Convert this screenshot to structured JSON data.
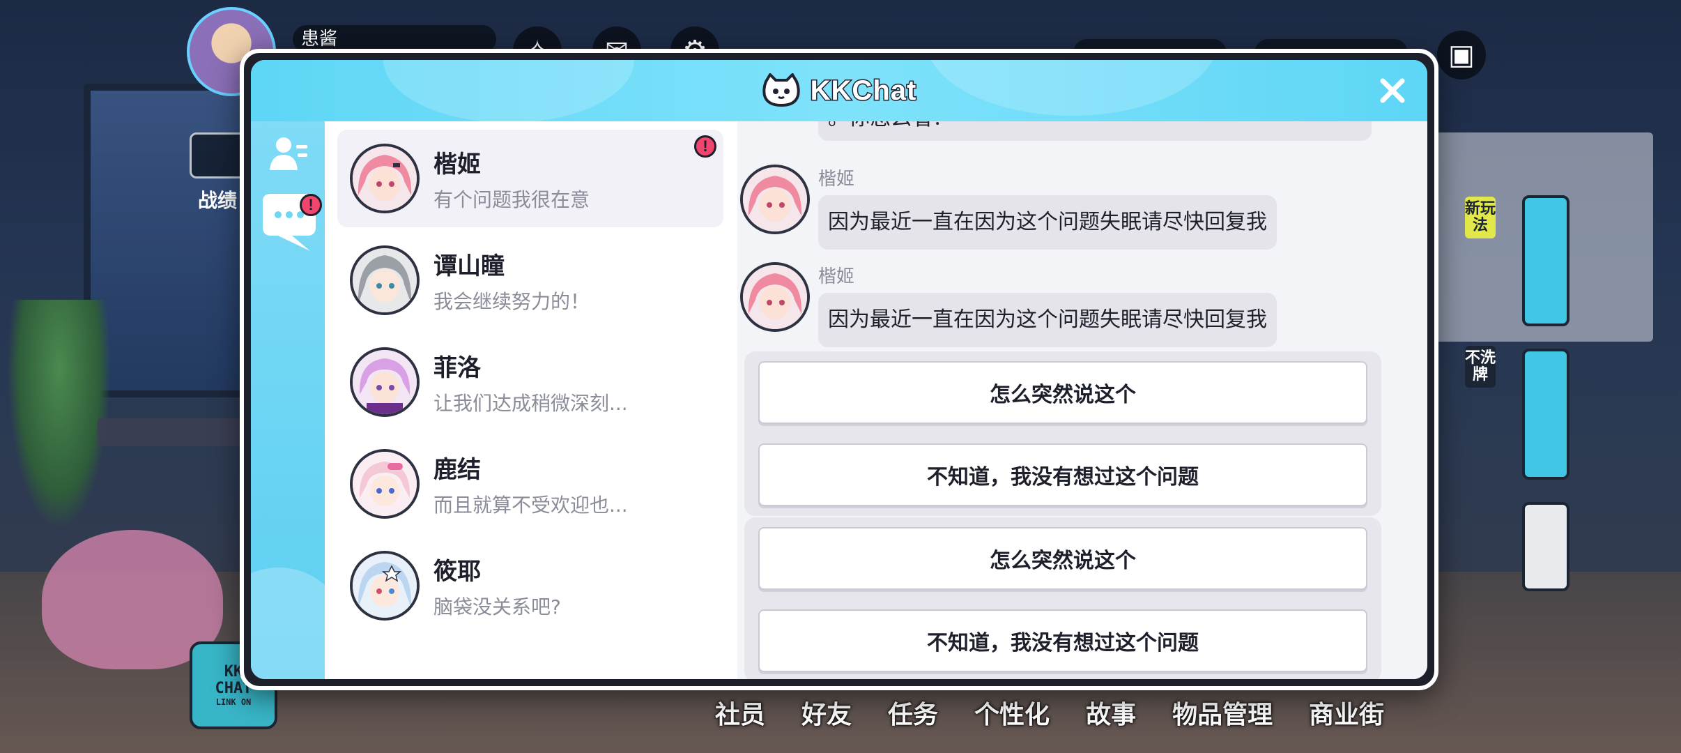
{
  "background": {
    "player_name": "患酱",
    "side_button_label": "战绩",
    "right_tags": [
      "新玩法",
      "不洗牌"
    ],
    "kkchat_button": [
      "KK",
      "CHAT",
      "LINK ON"
    ],
    "bottom_nav": [
      "社员",
      "好友",
      "任务",
      "个性化",
      "故事",
      "物品管理",
      "商业街"
    ]
  },
  "modal": {
    "title": "KKChat",
    "badge_glyph": "!",
    "rail": {
      "contacts_icon": "contacts-icon",
      "chat_icon": "chat-bubble-icon"
    },
    "contacts": [
      {
        "name": "楷姬",
        "preview": "有个问题我很在意",
        "active": true,
        "unread": true,
        "hair": "#f08aa0"
      },
      {
        "name": "谭山瞳",
        "preview": "我会继续努力的！",
        "active": false,
        "unread": false,
        "hair": "#9aa0a6"
      },
      {
        "name": "菲洛",
        "preview": "让我们达成稍微深刻...",
        "active": false,
        "unread": false,
        "hair": "#d9a0e6"
      },
      {
        "name": "鹿结",
        "preview": "而且就算不受欢迎也...",
        "active": false,
        "unread": false,
        "hair": "#f4c8d4"
      },
      {
        "name": "筱耶",
        "preview": "脑袋没关系吧?",
        "active": false,
        "unread": false,
        "hair": "#bcd6f2"
      }
    ],
    "chat": {
      "partial_message": "。你怎么看？",
      "messages": [
        {
          "sender": "楷姬",
          "text": "因为最近一直在因为这个问题失眠请尽快回复我"
        },
        {
          "sender": "楷姬",
          "text": "因为最近一直在因为这个问题失眠请尽快回复我"
        }
      ],
      "choice_groups": [
        [
          "怎么突然说这个",
          "不知道，我没有想过这个问题"
        ],
        [
          "怎么突然说这个",
          "不知道，我没有想过这个问题"
        ]
      ]
    }
  },
  "colors": {
    "header": "#5ed6f6",
    "rail": "#6fd6f4",
    "badge": "#f2456e",
    "panel": "#f3f4f8"
  }
}
